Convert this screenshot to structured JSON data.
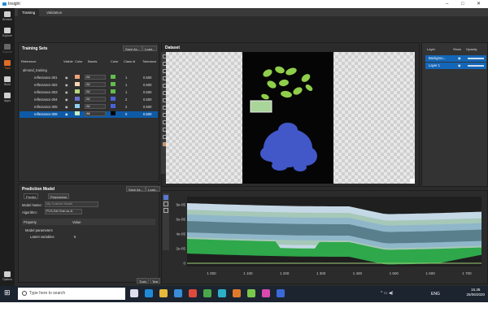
{
  "app": {
    "title": "Insight"
  },
  "left_toolbar": [
    {
      "label": "Browse",
      "state": "normal"
    },
    {
      "label": "Explore",
      "state": "normal"
    },
    {
      "label": "Explore",
      "state": "dim"
    },
    {
      "label": "Train",
      "state": "active"
    },
    {
      "label": "Build",
      "state": "normal"
    },
    {
      "label": "Apps",
      "state": "normal"
    }
  ],
  "options_label": "Options",
  "tabs": [
    "Training",
    "Validation"
  ],
  "training_sets": {
    "title": "Training Sets",
    "save_label": "Save As...",
    "load_label": "Load...",
    "headers": {
      "reference": "Reference",
      "visible": "Visible",
      "color": "Color",
      "bands": "Bands",
      "color2": "Color",
      "class_id": "Class id",
      "tolerance": "Tolerance"
    },
    "group": "almond_training",
    "rows": [
      {
        "name": "reflectance.001",
        "color": "#f0a27a",
        "bands": "All",
        "color2": "#5fbf4a",
        "class_id": "1",
        "tol": "0.500"
      },
      {
        "name": "reflectance.002",
        "color": "#f7d8b4",
        "bands": "All",
        "color2": "#5fbf4a",
        "class_id": "1",
        "tol": "0.500"
      },
      {
        "name": "reflectance.003",
        "color": "#b7d67a",
        "bands": "All",
        "color2": "#5fbf4a",
        "class_id": "1",
        "tol": "0.500"
      },
      {
        "name": "reflectance.004",
        "color": "#6a6fcf",
        "bands": "All",
        "color2": "#4a62d8",
        "class_id": "2",
        "tol": "0.500"
      },
      {
        "name": "reflectance.005",
        "color": "#8fd0f0",
        "bands": "All",
        "color2": "#4a62d8",
        "class_id": "2",
        "tol": "0.500"
      },
      {
        "name": "reflectance.006",
        "color": "#c8ecc0",
        "bands": "All",
        "color2": "#000000",
        "class_id": "0",
        "tol": "0.500"
      }
    ]
  },
  "dataset": {
    "title": "Dataset"
  },
  "layers": {
    "headers": {
      "layer": "Layer",
      "show": "Show",
      "opacity": "Opacity"
    },
    "items": [
      "Backgrou...",
      "Layer 1"
    ]
  },
  "prediction_model": {
    "title": "Prediction Model",
    "save_label": "Save As...",
    "load_label": "Load...",
    "tabs": [
      "Predict",
      "Preprocess"
    ],
    "model_name_label": "Model Name:",
    "model_name_value": "My Custom Model",
    "algorithm_label": "Algorithm:",
    "algorithm_value": "PLS-DA One-vs-A",
    "property_header": "Property",
    "value_header": "Value",
    "params_label": "Model parameters",
    "latent_label": "Latent variables",
    "latent_value": "5"
  },
  "buttons": {
    "train": "Train",
    "test": "Test"
  },
  "chart_data": {
    "type": "area",
    "x_ticks": [
      "1 000",
      "1 100",
      "1 200",
      "1 300",
      "1 400",
      "1 500",
      "1 600",
      "1 700"
    ],
    "y_ticks": [
      "8e-05",
      "6e-05",
      "4e-05",
      "2e-05",
      "0"
    ],
    "xlabel": "",
    "ylabel": "",
    "series_colors": [
      "#2ea84a",
      "#5a7f8c",
      "#8fb7c9",
      "#a6c8b8",
      "#c5d8e6"
    ]
  },
  "taskbar": {
    "search_placeholder": "Type here to search",
    "lang": "ENG",
    "time": "15.38",
    "date": "25/06/2020"
  }
}
